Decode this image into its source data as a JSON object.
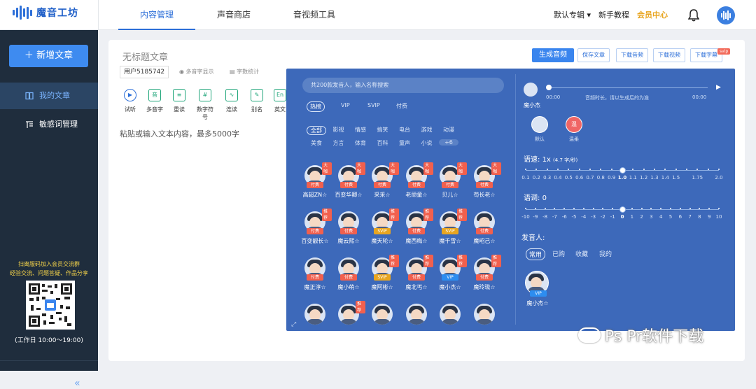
{
  "app": {
    "name": "魔音工坊",
    "accent": "#2d6fd8",
    "panel_bg": "#3d69ba",
    "sidebar_bg": "#1f2d3d"
  },
  "topnav": {
    "items": [
      "内容管理",
      "声音商店",
      "音视频工具"
    ],
    "active": 0
  },
  "topright": {
    "album": "默认专辑",
    "tutorial": "新手教程",
    "member": "会员中心"
  },
  "sidebar": {
    "new_button": "新增文章",
    "items": [
      {
        "label": "我的文章",
        "icon": "book-icon"
      },
      {
        "label": "敏感词管理",
        "icon": "word-filter-icon"
      }
    ],
    "qr_caption_1": "扫离服码加入会员交流群",
    "qr_caption_2": "经验交流、问题答疑、作品分享",
    "hours": "(工作日 10:00～19:00)",
    "collapse": "«"
  },
  "editor": {
    "title": "无标题文章",
    "user_tag": "用户5185742",
    "meta": [
      "多音字显示",
      "字数统计"
    ],
    "buttons": {
      "generate": "生成音频",
      "save": "保存文章",
      "download_audio": "下载音频",
      "download_video": "下载视频",
      "download_subtitle": "下载字幕",
      "svip": "svip"
    },
    "toolbar": [
      {
        "label": "试听",
        "icon": "play-icon"
      },
      {
        "label": "多音字",
        "icon": "polyphone-icon"
      },
      {
        "label": "重读",
        "icon": "stress-icon"
      },
      {
        "label": "数字符号",
        "icon": "number-icon"
      },
      {
        "label": "连读",
        "icon": "link-read-icon"
      },
      {
        "label": "别名",
        "icon": "alias-icon"
      },
      {
        "label": "英文",
        "icon": "english-icon"
      }
    ],
    "placeholder": "粘贴或输入文本内容，最多5000字"
  },
  "voice_panel": {
    "search_placeholder": "共200款发音人，输入名称搜索",
    "filter_tabs": [
      "热榜",
      "VIP",
      "SVIP",
      "付费"
    ],
    "categories_row1": [
      "全部",
      "影视",
      "情感",
      "搞笑",
      "电台",
      "游戏",
      "动漫"
    ],
    "categories_row2": [
      "美食",
      "方言",
      "体育",
      "百科",
      "童声",
      "小说",
      "+6"
    ],
    "voices": [
      {
        "name": "高超ZN",
        "badge": "付费",
        "corner": "大咖"
      },
      {
        "name": "百变华卿",
        "badge": "付费",
        "corner": "大咖"
      },
      {
        "name": "采采",
        "badge": "付费",
        "corner": "大咖"
      },
      {
        "name": "老顽童",
        "badge": "付费",
        "corner": "大咖"
      },
      {
        "name": "贝儿",
        "badge": "付费",
        "corner": "大咖"
      },
      {
        "name": "苟长老",
        "badge": "付费",
        "corner": "大咖"
      },
      {
        "name": "百变靓长",
        "badge": "付费",
        "corner": "推荐"
      },
      {
        "name": "魔云熙",
        "badge": "付费",
        "corner": ""
      },
      {
        "name": "魔天轮",
        "badge": "SVIP",
        "corner": "推荐"
      },
      {
        "name": "魔西梅",
        "badge": "付费",
        "corner": "推荐"
      },
      {
        "name": "魔千雪",
        "badge": "SVIP",
        "corner": "推荐"
      },
      {
        "name": "魔昭己",
        "badge": "付费",
        "corner": ""
      },
      {
        "name": "魔正淳",
        "badge": "付费",
        "corner": ""
      },
      {
        "name": "魔小萌",
        "badge": "付费",
        "corner": ""
      },
      {
        "name": "魔阿彬",
        "badge": "SVIP",
        "corner": "推荐"
      },
      {
        "name": "魔北丐",
        "badge": "付费",
        "corner": "推荐"
      },
      {
        "name": "魔小杰",
        "badge": "VIP",
        "corner": "推荐"
      },
      {
        "name": "魔玲珑",
        "badge": "付费",
        "corner": "推荐"
      },
      {
        "name": "",
        "badge": "",
        "corner": ""
      },
      {
        "name": "",
        "badge": "",
        "corner": "推荐"
      },
      {
        "name": "",
        "badge": "",
        "corner": ""
      },
      {
        "name": "",
        "badge": "",
        "corner": ""
      },
      {
        "name": "",
        "badge": "",
        "corner": ""
      },
      {
        "name": "",
        "badge": "",
        "corner": ""
      }
    ],
    "player": {
      "speaker": "魔小杰",
      "t_start": "00:00",
      "t_end": "00:00",
      "hint": "音频时长，请以生成后的为准"
    },
    "moods": [
      {
        "label": "默认",
        "icon": ""
      },
      {
        "label": "温柔",
        "icon": "温"
      }
    ],
    "speed": {
      "label": "语速:",
      "value": "1x",
      "detail": "(4.7 字/秒)",
      "ticks": [
        "0.1",
        "0.2",
        "0.3",
        "0.4",
        "0.5",
        "0.6",
        "0.7",
        "0.8",
        "0.9",
        "1.0",
        "1.1",
        "1.2",
        "1.3",
        "1.4",
        "1.5",
        "",
        "1.75",
        "",
        "2.0"
      ],
      "selected_index": 9
    },
    "pitch": {
      "label": "语调:",
      "value": "0",
      "ticks": [
        "-10",
        "-9",
        "-8",
        "-7",
        "-6",
        "-5",
        "-4",
        "-3",
        "-2",
        "-1",
        "0",
        "1",
        "2",
        "3",
        "4",
        "5",
        "6",
        "7",
        "8",
        "9",
        "10"
      ],
      "selected_index": 10
    },
    "speaker_section": {
      "label": "发音人:",
      "tabs": [
        "常用",
        "已购",
        "收藏",
        "我的"
      ],
      "selected": {
        "name": "魔小杰",
        "badge": "VIP"
      }
    }
  },
  "watermark": "Ps Pr软件下载"
}
